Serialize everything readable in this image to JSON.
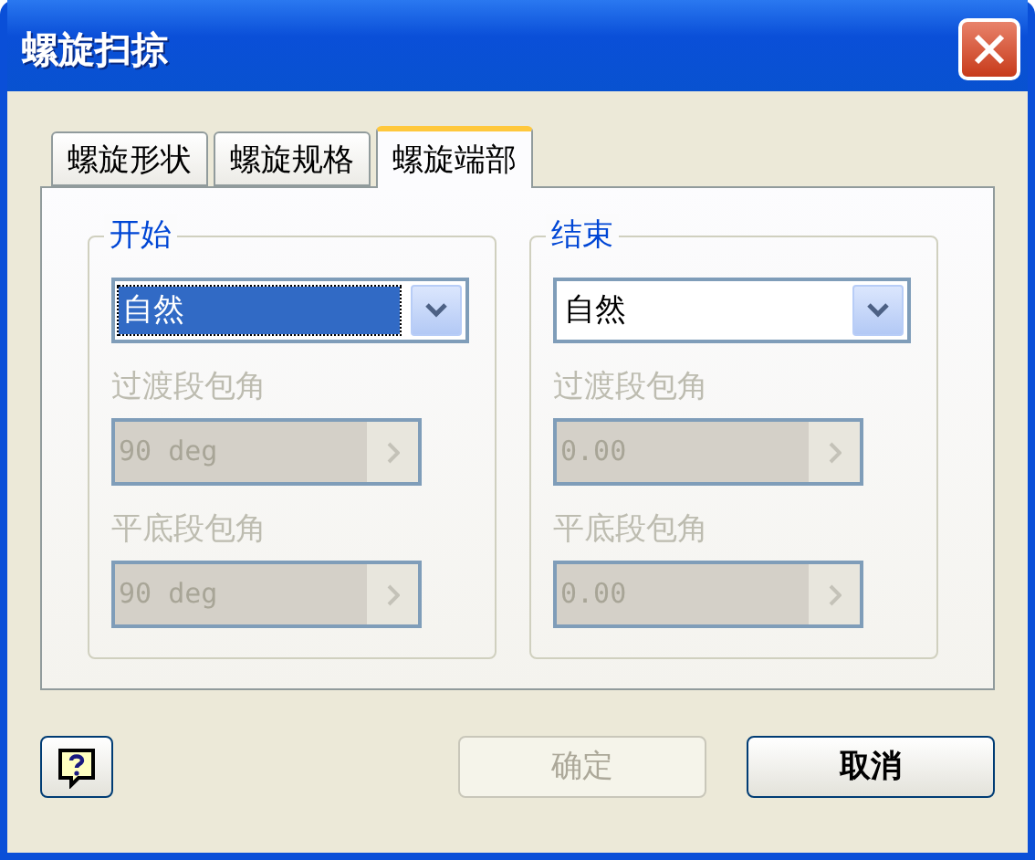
{
  "window": {
    "title": "螺旋扫掠"
  },
  "tabs": [
    {
      "label": "螺旋形状",
      "selected": false
    },
    {
      "label": "螺旋规格",
      "selected": false
    },
    {
      "label": "螺旋端部",
      "selected": true
    }
  ],
  "groups": [
    {
      "title": "开始",
      "dropdown": {
        "value": "自然",
        "focused": true
      },
      "fields": [
        {
          "label": "过渡段包角",
          "value": "90 deg",
          "disabled": true
        },
        {
          "label": "平底段包角",
          "value": "90 deg",
          "disabled": true
        }
      ]
    },
    {
      "title": "结束",
      "dropdown": {
        "value": "自然",
        "focused": false
      },
      "fields": [
        {
          "label": "过渡段包角",
          "value": "0.00",
          "disabled": true
        },
        {
          "label": "平底段包角",
          "value": "0.00",
          "disabled": true
        }
      ]
    }
  ],
  "buttons": [
    {
      "label": "确定",
      "disabled": true
    },
    {
      "label": "取消",
      "disabled": false
    }
  ]
}
